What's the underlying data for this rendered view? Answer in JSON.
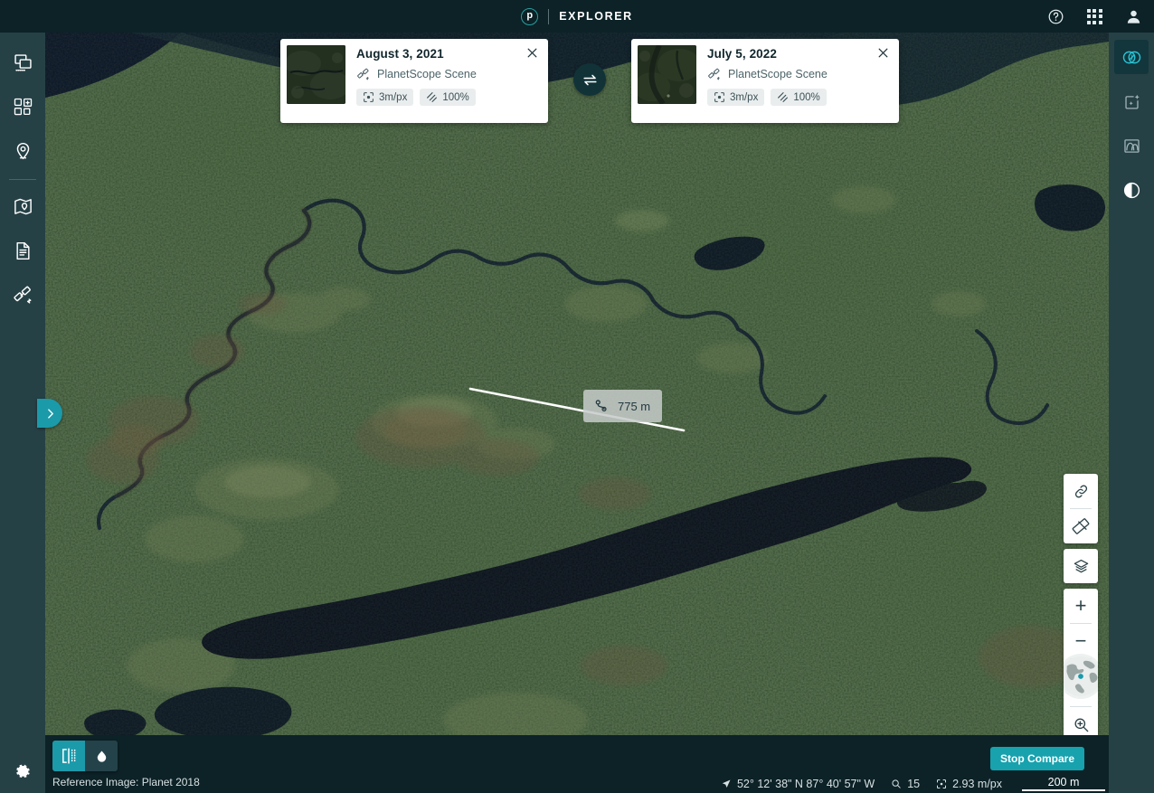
{
  "header": {
    "logo_letter": "p",
    "title": "EXPLORER",
    "help_icon": "help-circle-icon",
    "apps_icon": "app-grid-icon",
    "account_icon": "user-account-icon"
  },
  "left_rail": {
    "items": [
      {
        "name": "sidebar-item-scenes",
        "icon": "image-stack-icon",
        "label": "Scenes"
      },
      {
        "name": "sidebar-item-basemaps",
        "icon": "basemap-grid-icon",
        "label": "Basemaps"
      },
      {
        "name": "sidebar-item-places",
        "icon": "map-pin-icon",
        "label": "Places"
      },
      {
        "name": "sidebar-item-areas",
        "icon": "map-area-icon",
        "label": "My Areas"
      },
      {
        "name": "sidebar-item-reports",
        "icon": "document-icon",
        "label": "Reports"
      },
      {
        "name": "sidebar-item-tasking",
        "icon": "satellite-icon",
        "label": "Tasking"
      }
    ],
    "settings_icon": "gear-icon",
    "expander_icon": "chevron-right-icon"
  },
  "right_rail": {
    "items": [
      {
        "name": "tool-compare",
        "icon": "compare-overlap-icon",
        "active": true
      },
      {
        "name": "tool-enhance",
        "icon": "enhance-sparkle-icon",
        "active": false
      },
      {
        "name": "tool-histogram",
        "icon": "histogram-icon",
        "active": false
      },
      {
        "name": "tool-brightness",
        "icon": "contrast-icon",
        "active": false
      }
    ]
  },
  "compare": {
    "swap_icon": "swap-horizontal-icon",
    "cards": [
      {
        "date": "August 3, 2021",
        "type": "PlanetScope Scene",
        "type_icon": "satellite-icon",
        "resolution": "3m/px",
        "resolution_icon": "resolution-target-icon",
        "coverage": "100%",
        "coverage_icon": "coverage-hatch-icon",
        "close_icon": "close-icon"
      },
      {
        "date": "July 5, 2022",
        "type": "PlanetScope Scene",
        "type_icon": "satellite-icon",
        "resolution": "3m/px",
        "resolution_icon": "resolution-target-icon",
        "coverage": "100%",
        "coverage_icon": "coverage-hatch-icon",
        "close_icon": "close-icon"
      }
    ]
  },
  "measurement": {
    "distance": "775 m",
    "icon": "measure-route-icon"
  },
  "map_controls": {
    "share_link_icon": "link-icon",
    "measure_icon": "ruler-icon",
    "layers_icon": "layers-icon",
    "zoom_in_label": "+",
    "zoom_out_label": "−",
    "globe_icon": "globe-icon",
    "zoom_area_icon": "zoom-area-icon"
  },
  "bottom": {
    "split_mode_icon": "split-compare-icon",
    "blend_mode_icon": "opacity-drop-icon",
    "reference_text": "Reference Image: Planet 2018",
    "stop_compare_label": "Stop Compare",
    "coordinates": "52° 12' 38\" N 87° 40' 57\" W",
    "coordinates_icon": "cursor-arrow-icon",
    "zoom_level": "15",
    "zoom_icon": "magnifier-icon",
    "scale_value": "2.93 m/px",
    "scale_icon": "resolution-target-icon",
    "scalebar_label": "200 m"
  },
  "colors": {
    "accent_teal": "#1b9aaa",
    "header_bg": "#0c2227",
    "rail_bg": "#264146",
    "active_tool": "#29c2d4"
  }
}
